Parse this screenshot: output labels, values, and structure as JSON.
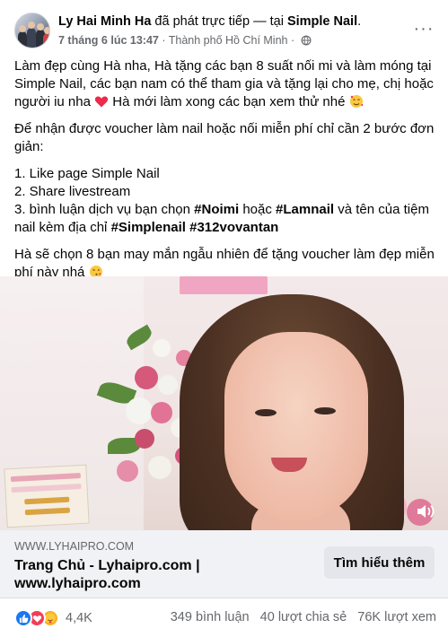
{
  "post": {
    "author": "Ly Hai Minh Ha",
    "action_text": "đã phát trực tiếp — tại",
    "location_tag": "Simple Nail",
    "location_tag_suffix": ".",
    "date": "7 tháng 6 lúc 13:47",
    "separator": "·",
    "city": "Thành phố Hồ Chí Minh",
    "privacy_sep": "·",
    "privacy_icon": "globe-icon",
    "more_icon": "more-options-icon",
    "more_text": "···"
  },
  "body": {
    "para1_a": "Làm đẹp cùng Hà nha, Hà tặng các bạn 8 suất nối mi và làm móng tại Simple Nail, các bạn nam có thể tham gia và tặng lại cho mẹ, chị hoặc người iu nha",
    "para1_b": "Hà mới làm xong các bạn xem thử nhé",
    "para2": "Để nhận được voucher làm nail hoặc nối miễn phí chỉ cần 2 bước đơn giản:",
    "step1": "1. Like page Simple Nail",
    "step2": "2. Share livestream",
    "step3_a": "3. bình luận dịch vụ bạn chọn",
    "tag_noimi": "#Noimi",
    "step3_or": "hoặc",
    "tag_lamnail": "#Lamnail",
    "step3_b": "và tên của tiệm nail kèm địa chỉ",
    "tag_simplenail": "#Simplenail",
    "tag_address": "#312vovantan",
    "para4": "Hà sẽ chọn 8 bạn may mắn ngẫu nhiên để tặng voucher làm đẹp miễn phí này nhá"
  },
  "link_preview": {
    "domain": "WWW.LYHAIPRO.COM",
    "title": "Trang Chủ - Lyhaipro.com | www.lyhaipro.com",
    "button": "Tìm hiểu thêm"
  },
  "stats": {
    "reaction_count": "4,4K",
    "comments": "349 bình luận",
    "shares": "40 lượt chia sẻ",
    "views": "76K lượt xem"
  },
  "colors": {
    "like": "#1877f2",
    "love": "#f33e58",
    "care": "#f7b125",
    "secondary_text": "#65676b",
    "link_bg": "#f0f2f5"
  }
}
